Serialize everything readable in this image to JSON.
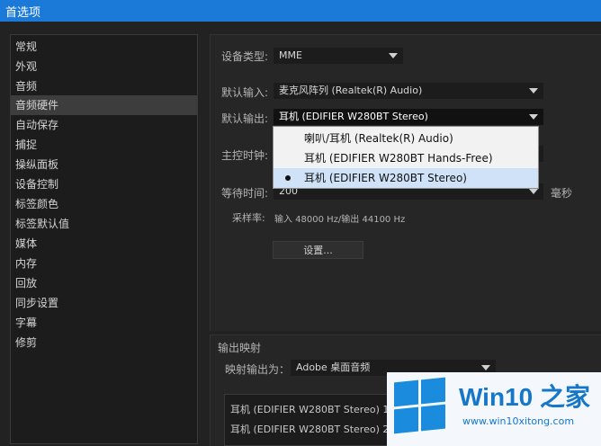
{
  "window": {
    "title": "首选项"
  },
  "sidebar": {
    "items": [
      {
        "label": "常规"
      },
      {
        "label": "外观"
      },
      {
        "label": "音频"
      },
      {
        "label": "音频硬件"
      },
      {
        "label": "自动保存"
      },
      {
        "label": "捕捉"
      },
      {
        "label": "操纵面板"
      },
      {
        "label": "设备控制"
      },
      {
        "label": "标签颜色"
      },
      {
        "label": "标签默认值"
      },
      {
        "label": "媒体"
      },
      {
        "label": "内存"
      },
      {
        "label": "回放"
      },
      {
        "label": "同步设置"
      },
      {
        "label": "字幕"
      },
      {
        "label": "修剪"
      }
    ],
    "selected": "音频硬件"
  },
  "device": {
    "type_label": "设备类型:",
    "type_value": "MME",
    "input_label": "默认输入:",
    "input_value": "麦克风阵列 (Realtek(R) Audio)",
    "output_label": "默认输出:",
    "output_value": "耳机 (EDIFIER W280BT Stereo)",
    "master_clock_label": "主控时钟:",
    "latency_label": "等待时间:",
    "latency_value": "200",
    "latency_unit": "毫秒",
    "sample_rate_label": "采样率:",
    "sample_rate_value": "输入 48000 Hz/输出 44100 Hz",
    "settings_button": "设置..."
  },
  "output_menu": {
    "options": [
      {
        "label": "喇叭/耳机 (Realtek(R) Audio)"
      },
      {
        "label": "耳机 (EDIFIER W280BT Hands-Free)"
      },
      {
        "label": "耳机 (EDIFIER W280BT Stereo)"
      }
    ],
    "selected_index": 2
  },
  "output_mapping": {
    "section_title": "输出映射",
    "map_label": "映射输出为：",
    "map_value": "Adobe 桌面音频",
    "channels": [
      {
        "label": "耳机 (EDIFIER W280BT Stereo) 1"
      },
      {
        "label": "耳机 (EDIFIER W280BT Stereo) 2"
      }
    ]
  },
  "watermark": {
    "title": "Win10 之家",
    "url": "www.win10xitong.com"
  },
  "colors": {
    "title_bar": "#1b7ad8",
    "background": "#222222",
    "menu_background": "#f2f2f2",
    "menu_selection": "#cfe2f7",
    "watermark_blue": "#1677c9"
  }
}
